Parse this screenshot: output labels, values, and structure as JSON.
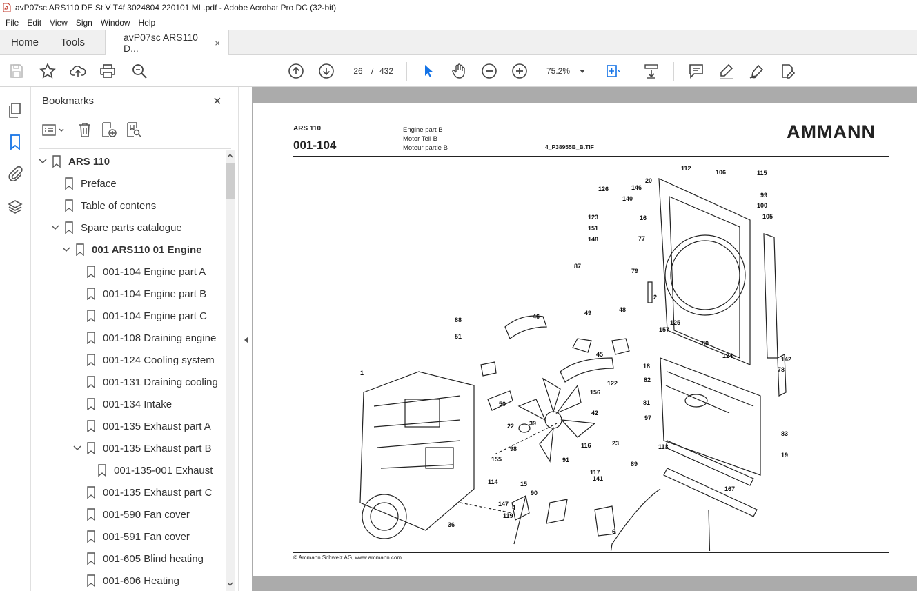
{
  "window": {
    "title": "avP07sc ARS110 DE St V T4f 3024804 220101 ML.pdf - Adobe Acrobat Pro DC (32-bit)"
  },
  "menu": [
    "File",
    "Edit",
    "View",
    "Sign",
    "Window",
    "Help"
  ],
  "tabs": {
    "home": "Home",
    "tools": "Tools",
    "doc": "avP07sc ARS110 D...",
    "close": "×"
  },
  "toolbar": {
    "page_current": "26",
    "page_sep": "/",
    "page_total": "432",
    "zoom": "75.2%"
  },
  "bookmarks": {
    "title": "Bookmarks",
    "close": "×",
    "items": [
      {
        "label": "ARS 110",
        "level": 0,
        "expanded": true,
        "bold": true
      },
      {
        "label": "Preface",
        "level": 1,
        "expanded": null,
        "bold": false
      },
      {
        "label": "Table of contens",
        "level": 1,
        "expanded": null,
        "bold": false
      },
      {
        "label": "Spare parts catalogue",
        "level": 1,
        "expanded": true,
        "bold": false
      },
      {
        "label": "001 ARS110 01 Engine",
        "level": 2,
        "expanded": true,
        "bold": true
      },
      {
        "label": "001-104 Engine part A",
        "level": 3,
        "expanded": null,
        "bold": false
      },
      {
        "label": "001-104 Engine part B",
        "level": 3,
        "expanded": null,
        "bold": false
      },
      {
        "label": "001-104 Engine part C",
        "level": 3,
        "expanded": null,
        "bold": false
      },
      {
        "label": "001-108 Draining engine",
        "level": 3,
        "expanded": null,
        "bold": false
      },
      {
        "label": "001-124 Cooling system",
        "level": 3,
        "expanded": null,
        "bold": false
      },
      {
        "label": "001-131 Draining cooling",
        "level": 3,
        "expanded": null,
        "bold": false
      },
      {
        "label": "001-134 Intake",
        "level": 3,
        "expanded": null,
        "bold": false
      },
      {
        "label": "001-135 Exhaust part A",
        "level": 3,
        "expanded": null,
        "bold": false
      },
      {
        "label": "001-135 Exhaust part B",
        "level": 3,
        "expanded": true,
        "bold": false
      },
      {
        "label": "001-135-001 Exhaust",
        "level": 4,
        "expanded": null,
        "bold": false
      },
      {
        "label": "001-135 Exhaust part C",
        "level": 3,
        "expanded": null,
        "bold": false
      },
      {
        "label": "001-590 Fan cover",
        "level": 3,
        "expanded": null,
        "bold": false
      },
      {
        "label": "001-591 Fan cover",
        "level": 3,
        "expanded": null,
        "bold": false
      },
      {
        "label": "001-605 Blind heating",
        "level": 3,
        "expanded": null,
        "bold": false
      },
      {
        "label": "001-606 Heating",
        "level": 3,
        "expanded": null,
        "bold": false
      }
    ]
  },
  "page": {
    "model": "ARS 110",
    "number": "001-104",
    "desc_en": "Engine part B",
    "desc_de": "Motor Teil B",
    "desc_fr": "Moteur partie B",
    "file": "4_P38955B_B.TIF",
    "logo": "AMMANN",
    "copyright": "© Ammann Schweiz AG, www.ammann.com"
  },
  "callouts": [
    "1",
    "2",
    "4",
    "6",
    "15",
    "16",
    "18",
    "19",
    "20",
    "22",
    "23",
    "36",
    "39",
    "42",
    "45",
    "46",
    "48",
    "49",
    "50",
    "51",
    "77",
    "78",
    "79",
    "80",
    "81",
    "82",
    "83",
    "87",
    "88",
    "89",
    "90",
    "91",
    "97",
    "98",
    "99",
    "100",
    "105",
    "106",
    "112",
    "113",
    "114",
    "115",
    "116",
    "117",
    "119",
    "122",
    "123",
    "124",
    "125",
    "126",
    "140",
    "141",
    "142",
    "146",
    "147",
    "148",
    "151",
    "155",
    "156",
    "157",
    "167"
  ]
}
